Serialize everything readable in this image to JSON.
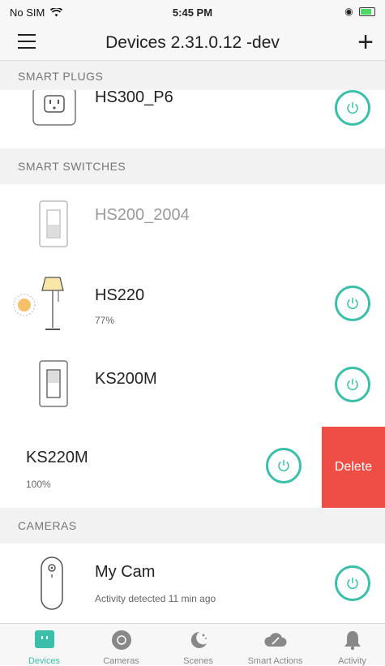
{
  "status_bar": {
    "carrier": "No SIM",
    "time": "5:45 PM"
  },
  "nav": {
    "title": "Devices 2.31.0.12 -dev"
  },
  "sections": {
    "plugs": "SMART PLUGS",
    "switches": "SMART SWITCHES",
    "cameras": "CAMERAS"
  },
  "devices": {
    "plug": {
      "name": "HS300_P6"
    },
    "hs200": {
      "name": "HS200_2004"
    },
    "hs220": {
      "name": "HS220",
      "level": "77%"
    },
    "ks200m": {
      "name": "KS200M"
    },
    "ks220m": {
      "name": "KS220M",
      "level": "100%",
      "delete_label": "Delete"
    },
    "cam": {
      "name": "My Cam",
      "activity": "Activity detected 11 min ago"
    }
  },
  "tabs": [
    {
      "label": "Devices"
    },
    {
      "label": "Cameras"
    },
    {
      "label": "Scenes"
    },
    {
      "label": "Smart Actions"
    },
    {
      "label": "Activity"
    }
  ],
  "colors": {
    "accent": "#3cbfa9",
    "delete": "#ee4e44",
    "bulb": "#f6c06a"
  }
}
